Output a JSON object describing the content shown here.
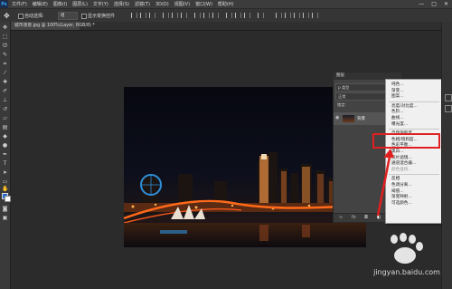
{
  "app": {
    "logo": "Ps"
  },
  "menu": [
    "文件(F)",
    "编辑(E)",
    "图像(I)",
    "图层(L)",
    "文字(Y)",
    "选择(S)",
    "滤镜(T)",
    "3D(D)",
    "视图(V)",
    "窗口(W)",
    "帮助(H)"
  ],
  "window_controls": [
    "—",
    "□",
    "✕"
  ],
  "options_bar": {
    "auto_select_label": "自动选择:",
    "auto_select_value": "组",
    "show_transform_label": "显示变换控件"
  },
  "doc_tab": {
    "title": "城市夜景.jpg @ 100%(Layer, RGB/8) *"
  },
  "layers_panel": {
    "title": "图层",
    "kind_label": "p 类型",
    "mode_label": "正常",
    "lock_label": "锁定:",
    "layer_name": "背景"
  },
  "context_menu": {
    "items": [
      {
        "label": "纯色...",
        "disabled": false
      },
      {
        "label": "渐变...",
        "disabled": false
      },
      {
        "label": "图案...",
        "disabled": false
      },
      {
        "sep": true
      },
      {
        "label": "亮度/对比度...",
        "disabled": false
      },
      {
        "label": "色阶...",
        "disabled": false
      },
      {
        "label": "曲线...",
        "disabled": false
      },
      {
        "label": "曝光度...",
        "disabled": false
      },
      {
        "sep": true
      },
      {
        "label": "自然饱和度...",
        "disabled": false
      },
      {
        "label": "色相/饱和度...",
        "disabled": false
      },
      {
        "label": "色彩平衡...",
        "disabled": false
      },
      {
        "label": "黑白...",
        "disabled": false
      },
      {
        "label": "照片滤镜...",
        "disabled": false
      },
      {
        "label": "通道混合器...",
        "disabled": false
      },
      {
        "label": "颜色查找...",
        "disabled": true
      },
      {
        "sep": true
      },
      {
        "label": "反相",
        "disabled": false
      },
      {
        "label": "色调分离...",
        "disabled": false
      },
      {
        "label": "阈值...",
        "disabled": false
      },
      {
        "label": "渐变映射...",
        "disabled": false
      },
      {
        "label": "可选颜色...",
        "disabled": false
      }
    ]
  },
  "watermark": {
    "text": "jingyan.baidu.com"
  },
  "colors": {
    "highlight": "#e02020",
    "accent": "#31a8ff"
  }
}
